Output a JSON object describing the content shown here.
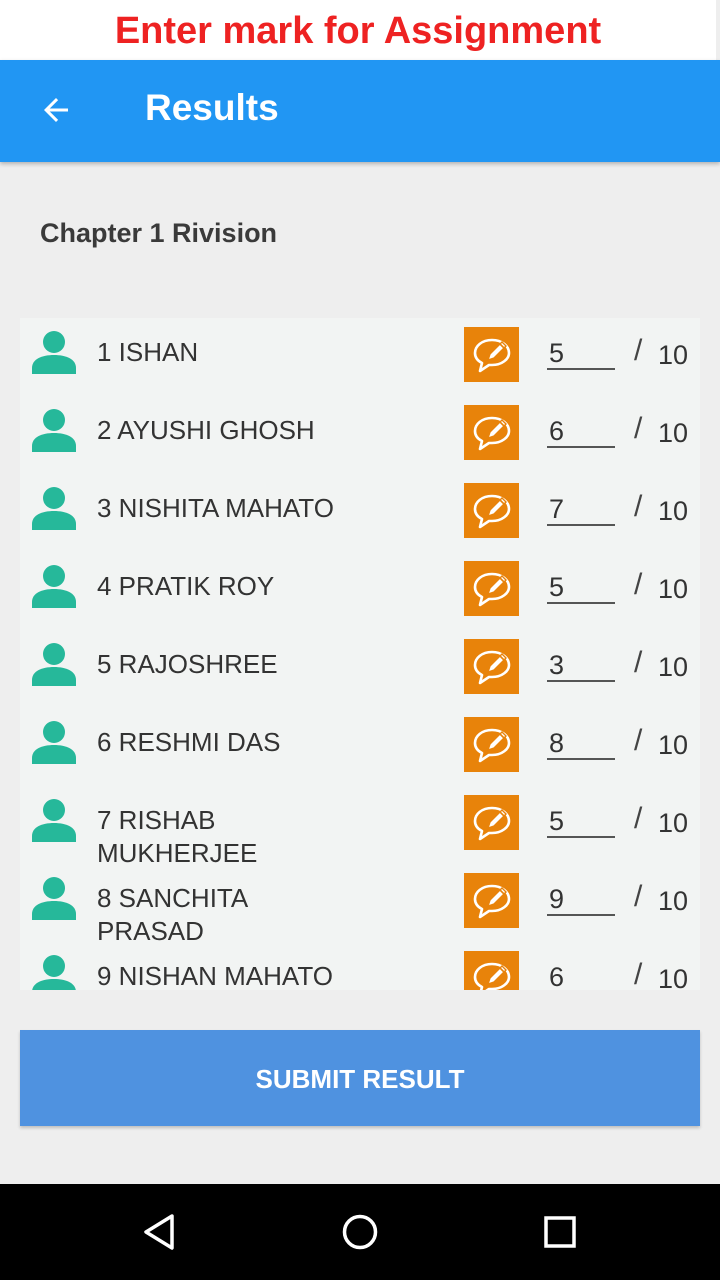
{
  "banner": {
    "text": "Enter mark for Assignment"
  },
  "appbar": {
    "title": "Results",
    "back_icon": "arrow-left-icon"
  },
  "section_title": "Chapter 1 Rivision",
  "students": [
    {
      "name": "1 ISHAN",
      "mark": "5",
      "total": "10"
    },
    {
      "name": "2 AYUSHI GHOSH",
      "mark": "6",
      "total": "10"
    },
    {
      "name": "3 NISHITA MAHATO",
      "mark": "7",
      "total": "10"
    },
    {
      "name": "4 PRATIK ROY",
      "mark": "5",
      "total": "10"
    },
    {
      "name": "5 RAJOSHREE",
      "mark": "3",
      "total": "10"
    },
    {
      "name": "6 RESHMI DAS",
      "mark": "8",
      "total": "10"
    },
    {
      "name": "7 RISHAB MUKHERJEE",
      "mark": "5",
      "total": "10"
    },
    {
      "name": "8 SANCHITA PRASAD",
      "mark": "9",
      "total": "10"
    },
    {
      "name": "9 NISHAN MAHATO",
      "mark": "6",
      "total": "10"
    }
  ],
  "separator": "/",
  "submit_label": "SUBMIT RESULT",
  "colors": {
    "appbar": "#2196f3",
    "banner_text": "#ee2222",
    "avatar": "#26b89a",
    "edit_button": "#e8830a",
    "submit": "#4f92e0"
  },
  "icons": {
    "avatar": "person-icon",
    "edit": "comment-edit-icon",
    "nav_back": "triangle-back-icon",
    "nav_home": "circle-home-icon",
    "nav_recents": "square-recents-icon"
  }
}
